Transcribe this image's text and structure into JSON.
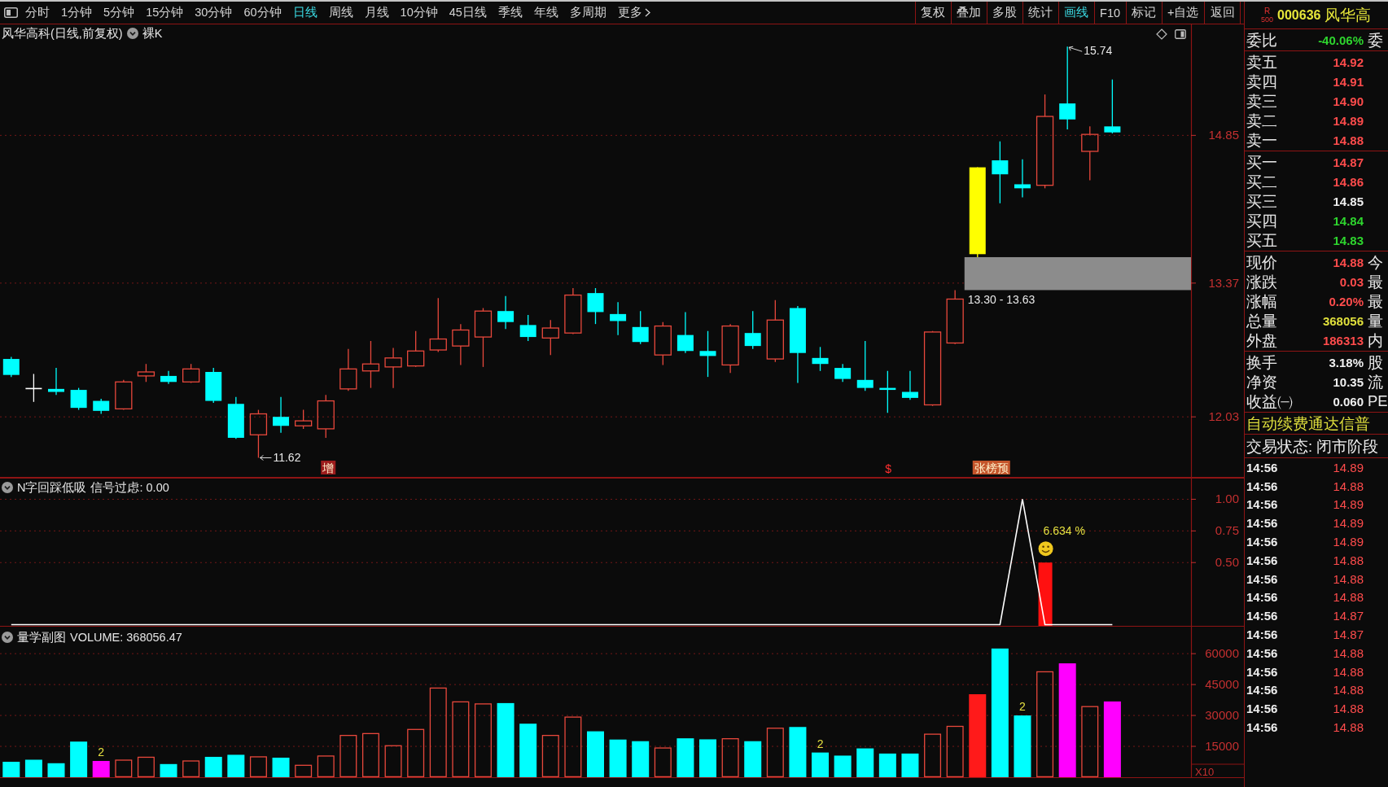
{
  "toolbar": {
    "periods": [
      {
        "label": "分时",
        "selected": false
      },
      {
        "label": "1分钟",
        "selected": false
      },
      {
        "label": "5分钟",
        "selected": false
      },
      {
        "label": "15分钟",
        "selected": false
      },
      {
        "label": "30分钟",
        "selected": false
      },
      {
        "label": "60分钟",
        "selected": false
      },
      {
        "label": "日线",
        "selected": true
      },
      {
        "label": "周线",
        "selected": false
      },
      {
        "label": "月线",
        "selected": false
      },
      {
        "label": "10分钟",
        "selected": false
      },
      {
        "label": "45日线",
        "selected": false
      },
      {
        "label": "季线",
        "selected": false
      },
      {
        "label": "年线",
        "selected": false
      },
      {
        "label": "多周期",
        "selected": false
      }
    ],
    "more_label": "更多",
    "tools": [
      {
        "label": "复权",
        "selected": false
      },
      {
        "label": "叠加",
        "selected": false
      },
      {
        "label": "多股",
        "selected": false
      },
      {
        "label": "统计",
        "selected": false
      },
      {
        "label": "画线",
        "selected": true
      },
      {
        "label": "F10",
        "selected": false
      },
      {
        "label": "标记",
        "selected": false
      },
      {
        "label": "+自选",
        "selected": false
      },
      {
        "label": "返回",
        "selected": false
      }
    ]
  },
  "main_panel": {
    "title": "风华高科(日线,前复权)",
    "toggle_label": "裸K",
    "extremes": {
      "high": "15.74",
      "low": "11.62"
    },
    "markers": [
      {
        "kind": "tag",
        "text": "增",
        "color": "#9c1c1c"
      },
      {
        "kind": "text",
        "text": "$",
        "color": "#ff3030"
      },
      {
        "kind": "tag",
        "text": "张榜预",
        "color": "#c4542a"
      }
    ],
    "chart_data": {
      "type": "candlestick",
      "ohlc": [
        [
          12.61,
          12.63,
          12.43,
          12.45
        ],
        [
          12.32,
          12.46,
          12.18,
          12.32
        ],
        [
          12.31,
          12.52,
          12.25,
          12.28
        ],
        [
          12.3,
          12.32,
          12.1,
          12.12
        ],
        [
          12.19,
          12.21,
          12.06,
          12.09
        ],
        [
          12.11,
          12.4,
          12.1,
          12.38
        ],
        [
          12.44,
          12.56,
          12.38,
          12.48
        ],
        [
          12.44,
          12.49,
          12.36,
          12.38
        ],
        [
          12.38,
          12.56,
          12.37,
          12.51
        ],
        [
          12.48,
          12.52,
          12.17,
          12.19
        ],
        [
          12.16,
          12.23,
          11.81,
          11.82
        ],
        [
          11.85,
          12.1,
          11.62,
          12.06
        ],
        [
          12.03,
          12.23,
          11.87,
          11.94
        ],
        [
          11.94,
          12.1,
          11.91,
          11.99
        ],
        [
          11.91,
          12.25,
          11.82,
          12.19
        ],
        [
          12.31,
          12.71,
          12.29,
          12.51
        ],
        [
          12.49,
          12.79,
          12.32,
          12.56
        ],
        [
          12.53,
          12.72,
          12.32,
          12.62
        ],
        [
          12.54,
          12.89,
          12.53,
          12.69
        ],
        [
          12.7,
          13.22,
          12.68,
          12.81
        ],
        [
          12.74,
          12.96,
          12.55,
          12.9
        ],
        [
          12.83,
          13.12,
          12.53,
          13.09
        ],
        [
          13.09,
          13.24,
          12.91,
          12.98
        ],
        [
          12.95,
          13.05,
          12.79,
          12.83
        ],
        [
          12.82,
          13.0,
          12.65,
          12.92
        ],
        [
          12.87,
          13.32,
          12.86,
          13.25
        ],
        [
          13.27,
          13.32,
          12.96,
          13.08
        ],
        [
          13.06,
          13.18,
          12.85,
          12.99
        ],
        [
          12.93,
          13.09,
          12.76,
          12.78
        ],
        [
          12.65,
          12.98,
          12.55,
          12.94
        ],
        [
          12.85,
          13.08,
          12.67,
          12.69
        ],
        [
          12.69,
          12.89,
          12.43,
          12.64
        ],
        [
          12.55,
          12.96,
          12.47,
          12.94
        ],
        [
          12.87,
          13.09,
          12.71,
          12.74
        ],
        [
          12.61,
          13.2,
          12.58,
          13.0
        ],
        [
          13.12,
          13.14,
          12.37,
          12.67
        ],
        [
          12.62,
          12.73,
          12.49,
          12.56
        ],
        [
          12.52,
          12.56,
          12.38,
          12.41
        ],
        [
          12.4,
          12.79,
          12.29,
          12.32
        ],
        [
          12.32,
          12.49,
          12.07,
          12.3
        ],
        [
          12.28,
          12.49,
          12.2,
          12.22
        ],
        [
          12.15,
          12.89,
          12.14,
          12.88
        ],
        [
          12.77,
          13.3,
          12.76,
          13.21
        ],
        [
          13.66,
          14.53,
          13.63,
          14.53
        ],
        [
          14.6,
          14.79,
          14.17,
          14.46
        ],
        [
          14.36,
          14.61,
          14.23,
          14.32
        ],
        [
          14.35,
          15.26,
          14.32,
          15.04
        ],
        [
          15.17,
          15.74,
          14.91,
          15.01
        ],
        [
          14.69,
          14.94,
          14.4,
          14.86
        ],
        [
          14.94,
          15.41,
          14.87,
          14.88
        ],
        null,
        null,
        null
      ],
      "colors": [
        "#00ffff",
        "#ffffff",
        "#00ffff",
        "#00ffff",
        "#00ffff",
        "#e8483c",
        "#e8483c",
        "#00ffff",
        "#e8483c",
        "#00ffff",
        "#00ffff",
        "#e8483c",
        "#00ffff",
        "#e8483c",
        "#e8483c",
        "#e8483c",
        "#e8483c",
        "#e8483c",
        "#e8483c",
        "#e8483c",
        "#e8483c",
        "#e8483c",
        "#00ffff",
        "#00ffff",
        "#e8483c",
        "#e8483c",
        "#00ffff",
        "#00ffff",
        "#00ffff",
        "#e8483c",
        "#00ffff",
        "#00ffff",
        "#e8483c",
        "#00ffff",
        "#e8483c",
        "#00ffff",
        "#00ffff",
        "#00ffff",
        "#00ffff",
        "#00ffff",
        "#00ffff",
        "#e8483c",
        "#e8483c",
        "#ffff00",
        "#00ffff",
        "#00ffff",
        "#e8483c",
        "#00ffff",
        "#e8483c",
        "#00ffff",
        null,
        null,
        null
      ],
      "ylim": [
        11.42,
        15.97
      ],
      "yticks": [
        {
          "value": 12.03,
          "label": "12.03"
        },
        {
          "value": 13.37,
          "label": "13.37"
        },
        {
          "value": 14.85,
          "label": "14.85"
        }
      ],
      "grid": true,
      "bands": [
        {
          "axis": "y",
          "from": 13.3,
          "to": 13.63,
          "label": "13.30 - 13.63",
          "color": "#8c8c8c"
        }
      ]
    }
  },
  "signal_panel": {
    "title": "N字回踩低吸",
    "reading": "信号过虑: 0.00",
    "signal_label": "6.634 %",
    "chart_data": {
      "type": "line",
      "series": [
        {
          "color": "#ffffff",
          "values": [
            0,
            0,
            0,
            0,
            0,
            0,
            0,
            0,
            0,
            0,
            0,
            0,
            0,
            0,
            0,
            0,
            0,
            0,
            0,
            0,
            0,
            0,
            0,
            0,
            0,
            0,
            0,
            0,
            0,
            0,
            0,
            0,
            0,
            0,
            0,
            0,
            0,
            0,
            0,
            0,
            0,
            0,
            0,
            0,
            0,
            1,
            0,
            0,
            0,
            0,
            null,
            null,
            null
          ]
        },
        {
          "type": "bar",
          "color": "#ff1010",
          "values": [
            null,
            null,
            null,
            null,
            null,
            null,
            null,
            null,
            null,
            null,
            null,
            null,
            null,
            null,
            null,
            null,
            null,
            null,
            null,
            null,
            null,
            null,
            null,
            null,
            null,
            null,
            null,
            null,
            null,
            null,
            null,
            null,
            null,
            null,
            null,
            null,
            null,
            null,
            null,
            null,
            null,
            null,
            null,
            null,
            null,
            null,
            0.5,
            null,
            null,
            null,
            null,
            null,
            null
          ]
        }
      ],
      "ylim": [
        0,
        1.17
      ],
      "yticks": [
        {
          "value": 0.5,
          "label": "0.50"
        },
        {
          "value": 0.75,
          "label": "0.75"
        },
        {
          "value": 1,
          "label": "1.00"
        }
      ],
      "grid": true
    }
  },
  "volume_panel": {
    "title": "量学副图",
    "reading": "VOLUME: 368056.47",
    "bar_notes": [
      "2",
      "2",
      "2"
    ],
    "chart_data": {
      "type": "bar",
      "values": [
        7500,
        8500,
        6800,
        17300,
        7900,
        8300,
        9700,
        6400,
        7900,
        9900,
        10900,
        9900,
        9500,
        5800,
        10300,
        20300,
        21200,
        15300,
        23200,
        43300,
        36600,
        35600,
        36000,
        26000,
        20300,
        29200,
        22300,
        18300,
        17500,
        14200,
        18900,
        18400,
        18700,
        17500,
        23800,
        24400,
        12000,
        10500,
        14000,
        11500,
        11500,
        20900,
        24700,
        40300,
        62500,
        30000,
        51200,
        55300,
        34300,
        36800,
        null,
        null,
        null
      ],
      "colors": [
        "#00ffff",
        "#00ffff",
        "#00ffff",
        "#00ffff",
        "#ff00ff",
        "#e8483c",
        "#e8483c",
        "#00ffff",
        "#e8483c",
        "#00ffff",
        "#00ffff",
        "#e8483c",
        "#00ffff",
        "#e8483c",
        "#e8483c",
        "#e8483c",
        "#e8483c",
        "#e8483c",
        "#e8483c",
        "#e8483c",
        "#e8483c",
        "#e8483c",
        "#00ffff",
        "#00ffff",
        "#e8483c",
        "#e8483c",
        "#00ffff",
        "#00ffff",
        "#00ffff",
        "#e8483c",
        "#00ffff",
        "#00ffff",
        "#e8483c",
        "#00ffff",
        "#e8483c",
        "#00ffff",
        "#00ffff",
        "#00ffff",
        "#00ffff",
        "#00ffff",
        "#00ffff",
        "#e8483c",
        "#e8483c",
        "#ff1a1a",
        "#00ffff",
        "#00ffff",
        "#e8483c",
        "#ff00ff",
        "#e8483c",
        "#ff00ff",
        null,
        null,
        null
      ],
      "ylim": [
        0,
        73500
      ],
      "yticks": [
        {
          "value": 15000,
          "label": "15000"
        },
        {
          "value": 30000,
          "label": "30000"
        },
        {
          "value": 45000,
          "label": "45000"
        },
        {
          "value": 60000,
          "label": "60000"
        }
      ],
      "ylabel": "X10",
      "grid": true
    }
  },
  "quote_panel": {
    "flag": "R",
    "flag_index": "500",
    "code": "000636",
    "name": "风华高",
    "ratio": {
      "label": "委比",
      "value": "-40.06%",
      "color": "#2ed52e",
      "side_label": "委"
    },
    "asks": [
      {
        "label": "卖五",
        "value": "14.92",
        "color": "#ff4c4c"
      },
      {
        "label": "卖四",
        "value": "14.91",
        "color": "#ff4c4c"
      },
      {
        "label": "卖三",
        "value": "14.90",
        "color": "#ff4c4c"
      },
      {
        "label": "卖二",
        "value": "14.89",
        "color": "#ff4c4c"
      },
      {
        "label": "卖一",
        "value": "14.88",
        "color": "#ff4c4c"
      }
    ],
    "bids": [
      {
        "label": "买一",
        "value": "14.87",
        "color": "#ff4c4c"
      },
      {
        "label": "买二",
        "value": "14.86",
        "color": "#ff4c4c"
      },
      {
        "label": "买三",
        "value": "14.85",
        "color": "#f0f0f0"
      },
      {
        "label": "买四",
        "value": "14.84",
        "color": "#2ed52e"
      },
      {
        "label": "买五",
        "value": "14.83",
        "color": "#2ed52e"
      }
    ],
    "stats": [
      {
        "label": "现价",
        "value": "14.88",
        "color": "#ff4c4c",
        "side_label": "今"
      },
      {
        "label": "涨跌",
        "value": "0.03",
        "color": "#ff4c4c",
        "side_label": "最"
      },
      {
        "label": "涨幅",
        "value": "0.20%",
        "color": "#ff4c4c",
        "side_label": "最"
      },
      {
        "label": "总量",
        "value": "368056",
        "color": "#e0e03c",
        "side_label": "量"
      },
      {
        "label": "外盘",
        "value": "186313",
        "color": "#ff4c4c",
        "side_label": "内"
      }
    ],
    "fundamentals": [
      {
        "label": "换手",
        "value": "3.18%",
        "color": "#f0f0f0",
        "side_label": "股"
      },
      {
        "label": "净资",
        "value": "10.35",
        "color": "#f0f0f0",
        "side_label": "流"
      },
      {
        "label": "收益㈠",
        "value": "0.060",
        "color": "#f0f0f0",
        "side_label": "PE"
      }
    ],
    "notice": "自动续费通达信普",
    "status": "交易状态: 闭市阶段",
    "ticks": [
      {
        "time": "14:56",
        "price": "14.89"
      },
      {
        "time": "14:56",
        "price": "14.88"
      },
      {
        "time": "14:56",
        "price": "14.89"
      },
      {
        "time": "14:56",
        "price": "14.89"
      },
      {
        "time": "14:56",
        "price": "14.89"
      },
      {
        "time": "14:56",
        "price": "14.88"
      },
      {
        "time": "14:56",
        "price": "14.88"
      },
      {
        "time": "14:56",
        "price": "14.88"
      },
      {
        "time": "14:56",
        "price": "14.87"
      },
      {
        "time": "14:56",
        "price": "14.87"
      },
      {
        "time": "14:56",
        "price": "14.88"
      },
      {
        "time": "14:56",
        "price": "14.88"
      },
      {
        "time": "14:56",
        "price": "14.88"
      },
      {
        "time": "14:56",
        "price": "14.88"
      },
      {
        "time": "14:56",
        "price": "14.88"
      }
    ]
  }
}
